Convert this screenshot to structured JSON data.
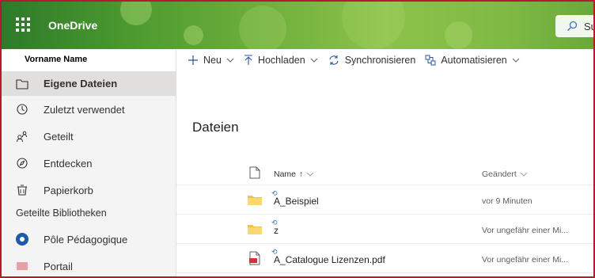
{
  "topbar": {
    "app_name": "OneDrive",
    "search_text": "Su"
  },
  "sidebar": {
    "user_name": "Vorname Name",
    "items": [
      {
        "label": "Eigene Dateien",
        "icon": "folder-icon",
        "active": true
      },
      {
        "label": "Zuletzt verwendet",
        "icon": "clock-icon"
      },
      {
        "label": "Geteilt",
        "icon": "people-icon"
      },
      {
        "label": "Entdecken",
        "icon": "compass-icon"
      },
      {
        "label": "Papierkorb",
        "icon": "trash-icon"
      }
    ],
    "shared_libraries_title": "Geteilte Bibliotheken",
    "libraries": [
      {
        "label": "Pôle Pédagogique",
        "icon": "library-badge-icon"
      }
    ],
    "cut_off_item": "Portail"
  },
  "commands": {
    "new": "Neu",
    "upload": "Hochladen",
    "sync": "Synchronisieren",
    "automate": "Automatisieren"
  },
  "main": {
    "title": "Dateien",
    "columns": {
      "name": "Name",
      "sort_arrow": "↑",
      "modified": "Geändert"
    },
    "files": [
      {
        "name": "A_Beispiel",
        "modified": "vor 9 Minuten",
        "type": "folder"
      },
      {
        "name": "z",
        "modified": "Vor ungefähr einer Mi...",
        "type": "folder"
      },
      {
        "name": "A_Catalogue Lizenzen.pdf",
        "modified": "Vor ungefähr einer Mi...",
        "type": "pdf"
      }
    ]
  },
  "colors": {
    "frame": "#b41a2e",
    "brand_green": "#4c9a2f",
    "folder": "#f2c14e",
    "accent_blue": "#1e5aa8"
  }
}
